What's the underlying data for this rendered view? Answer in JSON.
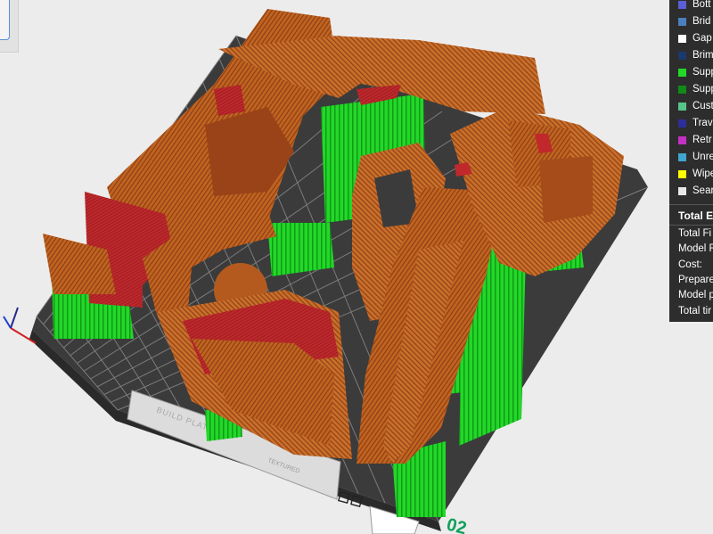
{
  "legend": {
    "items": [
      {
        "label": "Bott",
        "color": "#5a5fd6"
      },
      {
        "label": "Brid",
        "color": "#4c7fc0"
      },
      {
        "label": "Gap",
        "color": "#ffffff"
      },
      {
        "label": "Brim",
        "color": "#1a3a6e"
      },
      {
        "label": "Supp",
        "color": "#22d828"
      },
      {
        "label": "Supp",
        "color": "#108a18"
      },
      {
        "label": "Cust",
        "color": "#56c48a"
      },
      {
        "label": "Trav",
        "color": "#2e2e9a"
      },
      {
        "label": "Retr",
        "color": "#c430c4"
      },
      {
        "label": "Unre",
        "color": "#3fa6cf"
      },
      {
        "label": "Wipe",
        "color": "#ffff00"
      },
      {
        "label": "Sear",
        "color": "#e8e8e8"
      }
    ],
    "summary_title": "Total E",
    "stats": [
      "Total Fi",
      "Model F",
      "Cost:",
      "Prepare",
      "Model p",
      "Total tir"
    ]
  },
  "bed": {
    "plate_number": "02",
    "plate_label": "BUILD PLATE",
    "sub_label": "TEXTURED"
  },
  "colors": {
    "background": "#ececec",
    "bed": "#3c3c3c",
    "grid": "#7a7a7a",
    "model": "#c06420",
    "model_top": "#cf7a2c",
    "model_dark": "#8a3a14",
    "overhang": "#c0282c",
    "support": "#22d828",
    "support_dark": "#0f8a16",
    "plate_number": "#0ea05a",
    "legend_bg": "#2d2d2d"
  },
  "icons": [
    "axis-gizmo-icon",
    "lock-icon",
    "home-icon"
  ]
}
